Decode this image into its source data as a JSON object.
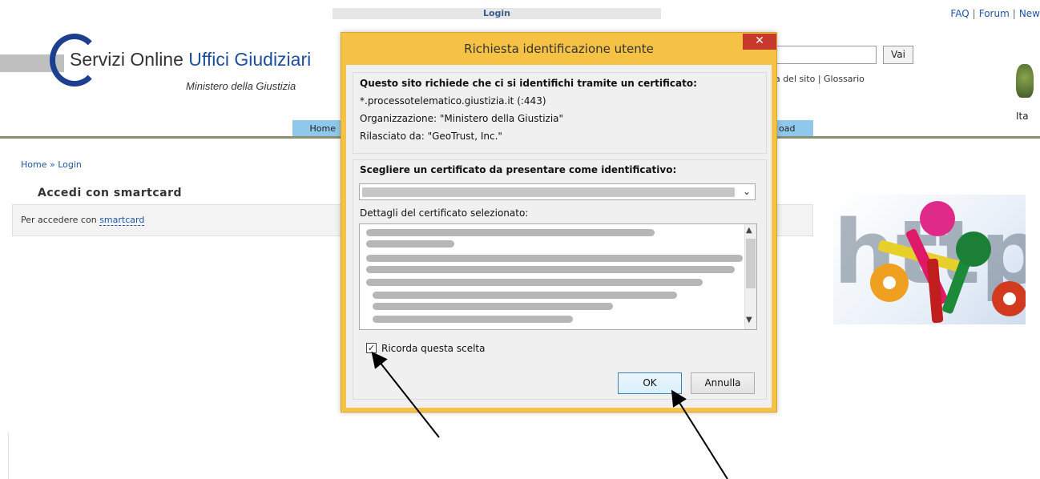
{
  "page": {
    "top_tab": "Login",
    "top_links": [
      "FAQ",
      "Forum",
      "New"
    ],
    "logo": {
      "text_part1": "Servizi Online",
      "text_part2": "Uffici Giudiziari",
      "subtitle": "Ministero della Giustizia"
    },
    "search": {
      "value": "",
      "button": "Vai"
    },
    "site_links": "ppa del sito | Glossario",
    "right_label": "Ita",
    "nav": {
      "home": "Home",
      "right_tab": "oad"
    },
    "breadcrumb": "Home » Login",
    "section_title": "Accedi con smartcard",
    "section_text_prefix": "Per accedere con ",
    "section_link": "smartcard"
  },
  "dialog": {
    "title": "Richiesta identificazione utente",
    "close_glyph": "✕",
    "info_heading": "Questo sito richiede che ci si identifichi tramite un certificato:",
    "site": "*.processotelematico.giustizia.it (:443)",
    "organization": "Organizzazione: \"Ministero della Giustizia\"",
    "issuer": "Rilasciato da: \"GeoTrust, Inc.\"",
    "choose_heading": "Scegliere un certificato da presentare come identificativo:",
    "details_label": "Dettagli del certificato selezionato:",
    "remember_label": "Ricorda questa scelta",
    "remember_checked": true,
    "ok_label": "OK",
    "cancel_label": "Annulla"
  },
  "colors": {
    "dialog_frame": "#f5c246",
    "close_button": "#c7392b",
    "nav_tab": "#8fc8ea",
    "link": "#1f56a8"
  }
}
